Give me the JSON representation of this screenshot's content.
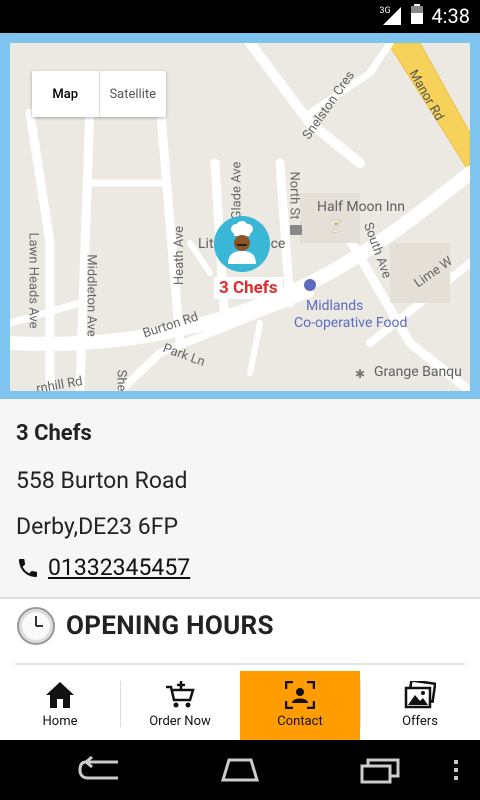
{
  "status_bar": {
    "time": "4:38",
    "network": "3G"
  },
  "map": {
    "toggle": {
      "map_label": "Map",
      "satellite_label": "Satellite"
    },
    "streets": {
      "snelston": "Snelston Cres",
      "manor": "Manor Rd",
      "lawn_heads": "Lawn Heads Ave",
      "middleton": "Middleton Ave",
      "heath": "Heath Ave",
      "glade": "Glade Ave",
      "north": "North St",
      "south": "South Ave",
      "lime": "Lime W",
      "burton": "Burton Rd",
      "park": "Park Ln",
      "hill": "rnhill Rd",
      "she": "She"
    },
    "places": {
      "half_moon": "Half Moon Inn",
      "post_office": "Lit        Post Office",
      "midlands": "Midlands",
      "coop": "Co-operative Food",
      "grange": "Grange Banqu"
    },
    "marker_label": "3 Chefs"
  },
  "restaurant": {
    "name": "3 Chefs",
    "address_line1": "558 Burton Road",
    "address_line2": "Derby,DE23 6FP",
    "phone": "01332345457"
  },
  "opening_hours": {
    "title": "OPENING HOURS"
  },
  "bottom_nav": [
    {
      "label": "Home",
      "icon": "home-icon"
    },
    {
      "label": "Order Now",
      "icon": "cart-icon"
    },
    {
      "label": "Contact",
      "icon": "contact-icon"
    },
    {
      "label": "Offers",
      "icon": "gallery-icon"
    }
  ],
  "colors": {
    "accent": "#fe9c00",
    "map_border": "#7ec4ef",
    "pin": "#3ab6d6",
    "marker_text": "#e22b2b"
  }
}
